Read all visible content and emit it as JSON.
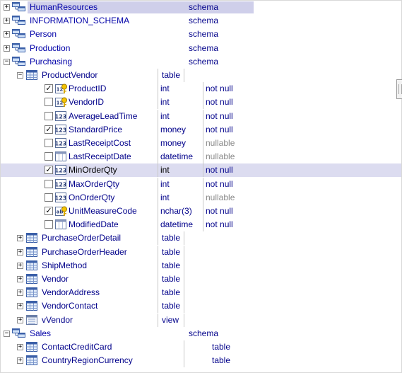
{
  "tree": {
    "schemas_top": [
      {
        "name": "HumanResources",
        "kind": "schema"
      },
      {
        "name": "INFORMATION_SCHEMA",
        "kind": "schema"
      },
      {
        "name": "Person",
        "kind": "schema"
      },
      {
        "name": "Production",
        "kind": "schema"
      },
      {
        "name": "Purchasing",
        "kind": "schema"
      }
    ],
    "product_vendor": {
      "name": "ProductVendor",
      "kind": "table"
    },
    "columns": [
      {
        "name": "ProductID",
        "type": "int",
        "nullability": "not null",
        "checked": true,
        "icon": "pk-int-icon"
      },
      {
        "name": "VendorID",
        "type": "int",
        "nullability": "not null",
        "checked": false,
        "icon": "pk-int-icon"
      },
      {
        "name": "AverageLeadTime",
        "type": "int",
        "nullability": "not null",
        "checked": false,
        "icon": "numeric-icon"
      },
      {
        "name": "StandardPrice",
        "type": "money",
        "nullability": "not null",
        "checked": true,
        "icon": "numeric-icon"
      },
      {
        "name": "LastReceiptCost",
        "type": "money",
        "nullability": "nullable",
        "checked": false,
        "icon": "numeric-icon"
      },
      {
        "name": "LastReceiptDate",
        "type": "datetime",
        "nullability": "nullable",
        "checked": false,
        "icon": "datetime-icon"
      },
      {
        "name": "MinOrderQty",
        "type": "int",
        "nullability": "not null",
        "checked": true,
        "icon": "numeric-icon"
      },
      {
        "name": "MaxOrderQty",
        "type": "int",
        "nullability": "not null",
        "checked": false,
        "icon": "numeric-icon"
      },
      {
        "name": "OnOrderQty",
        "type": "int",
        "nullability": "nullable",
        "checked": false,
        "icon": "numeric-icon"
      },
      {
        "name": "UnitMeasureCode",
        "type": "nchar(3)",
        "nullability": "not null",
        "checked": true,
        "icon": "pk-text-icon"
      },
      {
        "name": "ModifiedDate",
        "type": "datetime",
        "nullability": "not null",
        "checked": false,
        "icon": "datetime-icon"
      }
    ],
    "purchasing_tables": [
      {
        "name": "PurchaseOrderDetail",
        "kind": "table"
      },
      {
        "name": "PurchaseOrderHeader",
        "kind": "table"
      },
      {
        "name": "ShipMethod",
        "kind": "table"
      },
      {
        "name": "Vendor",
        "kind": "table"
      },
      {
        "name": "VendorAddress",
        "kind": "table"
      },
      {
        "name": "VendorContact",
        "kind": "table"
      },
      {
        "name": "vVendor",
        "kind": "view"
      }
    ],
    "sales": {
      "name": "Sales",
      "kind": "schema"
    },
    "sales_tables": [
      {
        "name": "ContactCreditCard",
        "kind": "table"
      },
      {
        "name": "CountryRegionCurrency",
        "kind": "table"
      }
    ],
    "colors": {
      "accent": "#00008a",
      "selection": "#dcdcf0",
      "nullable": "#888888"
    }
  }
}
